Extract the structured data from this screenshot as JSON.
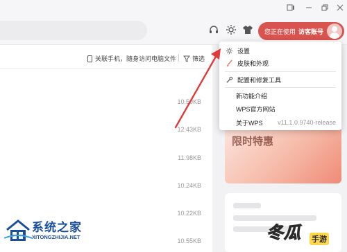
{
  "window": {
    "controls": [
      "square-dot-icon",
      "minimize-icon",
      "restore-icon",
      "close-icon"
    ]
  },
  "toolbar": {
    "account_prefix": "您正在使用",
    "account_name": "访客账号",
    "icons": [
      "headset-icon",
      "gear-icon",
      "shirt-icon"
    ]
  },
  "filter_bar": {
    "phone_link": "关联手机，随身访问电脑文件",
    "filter_label": "筛选"
  },
  "file_sizes": [
    "10.50KB",
    "12.43KB",
    "11.98KB",
    "10.24KB",
    "10.22KB",
    "10.55KB"
  ],
  "right_panel": {
    "banner_title": "限时特惠"
  },
  "menu": {
    "items": [
      {
        "label": "设置",
        "icon": "gear-icon"
      },
      {
        "label": "皮肤和外观",
        "icon": "brush-icon"
      },
      {
        "label": "配置和修复工具",
        "icon": "wrench-icon"
      },
      {
        "label": "新功能介绍"
      },
      {
        "label": "WPS官方网站"
      },
      {
        "label": "关于WPS",
        "version": "v11.1.0.9740-release"
      }
    ]
  },
  "annotation": {
    "arrow_color": "#e03a3a"
  },
  "watermark_left": {
    "cn": "系统之家",
    "en": "XITONGZHIJIA.NET"
  },
  "watermark_right": {
    "text": "冬瓜",
    "sub": "手游"
  },
  "colors": {
    "accent": "#d9534f",
    "brand_blue": "#1a4f9c"
  }
}
